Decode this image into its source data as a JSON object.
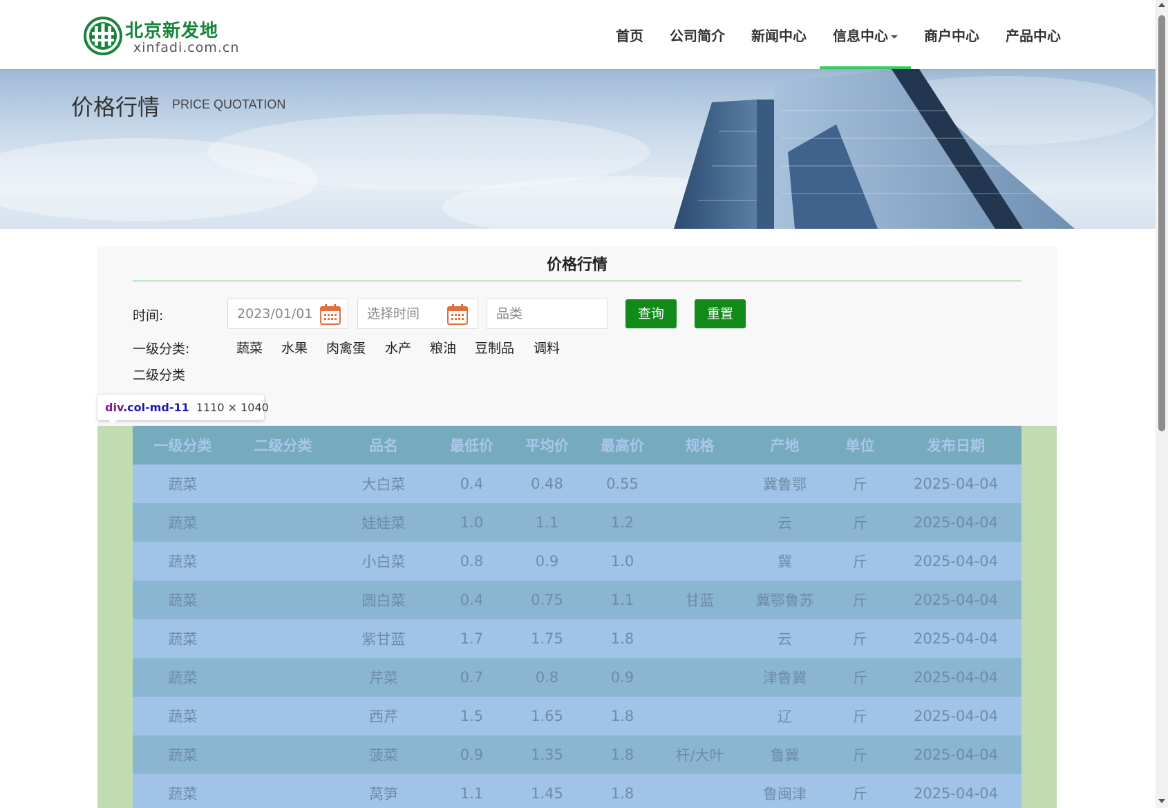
{
  "logo": {
    "cn": "北京新发地",
    "en": "xinfadi.com.cn"
  },
  "nav": {
    "items": [
      {
        "label": "首页"
      },
      {
        "label": "公司简介"
      },
      {
        "label": "新闻中心"
      },
      {
        "label": "信息中心"
      },
      {
        "label": "商户中心"
      },
      {
        "label": "产品中心"
      }
    ],
    "active_index": 3
  },
  "banner": {
    "title": "价格行情",
    "subtitle": "PRICE QUOTATION"
  },
  "panel": {
    "title": "价格行情"
  },
  "filters": {
    "time_label": "时间:",
    "start_date": "2023/01/01",
    "end_date_placeholder": "选择时间",
    "category_placeholder": "品类",
    "query_button": "查询",
    "reset_button": "重置",
    "level1_label": "一级分类:",
    "level1_items": [
      "蔬菜",
      "水果",
      "肉禽蛋",
      "水产",
      "粮油",
      "豆制品",
      "调料"
    ],
    "level2_label": "二级分类"
  },
  "devtools_tooltip": {
    "tag": "div",
    "class": ".col-md-11",
    "dims": "1110 × 1040"
  },
  "table": {
    "headers": [
      "一级分类",
      "二级分类",
      "品名",
      "最低价",
      "平均价",
      "最高价",
      "规格",
      "产地",
      "单位",
      "发布日期"
    ],
    "rows": [
      [
        "蔬菜",
        "",
        "大白菜",
        "0.4",
        "0.48",
        "0.55",
        "",
        "冀鲁鄂",
        "斤",
        "2025-04-04"
      ],
      [
        "蔬菜",
        "",
        "娃娃菜",
        "1.0",
        "1.1",
        "1.2",
        "",
        "云",
        "斤",
        "2025-04-04"
      ],
      [
        "蔬菜",
        "",
        "小白菜",
        "0.8",
        "0.9",
        "1.0",
        "",
        "冀",
        "斤",
        "2025-04-04"
      ],
      [
        "蔬菜",
        "",
        "圆白菜",
        "0.4",
        "0.75",
        "1.1",
        "甘蓝",
        "冀鄂鲁苏",
        "斤",
        "2025-04-04"
      ],
      [
        "蔬菜",
        "",
        "紫甘蓝",
        "1.7",
        "1.75",
        "1.8",
        "",
        "云",
        "斤",
        "2025-04-04"
      ],
      [
        "蔬菜",
        "",
        "芹菜",
        "0.7",
        "0.8",
        "0.9",
        "",
        "津鲁冀",
        "斤",
        "2025-04-04"
      ],
      [
        "蔬菜",
        "",
        "西芹",
        "1.5",
        "1.65",
        "1.8",
        "",
        "辽",
        "斤",
        "2025-04-04"
      ],
      [
        "蔬菜",
        "",
        "菠菜",
        "0.9",
        "1.35",
        "1.8",
        "杆/大叶",
        "鲁冀",
        "斤",
        "2025-04-04"
      ],
      [
        "蔬菜",
        "",
        "莴笋",
        "1.1",
        "1.45",
        "1.8",
        "",
        "鲁闽津",
        "斤",
        "2025-04-04"
      ]
    ]
  },
  "colors": {
    "accent_green": "#2fcd5a",
    "button_green": "#118a1a",
    "brand_green": "#17833a"
  }
}
